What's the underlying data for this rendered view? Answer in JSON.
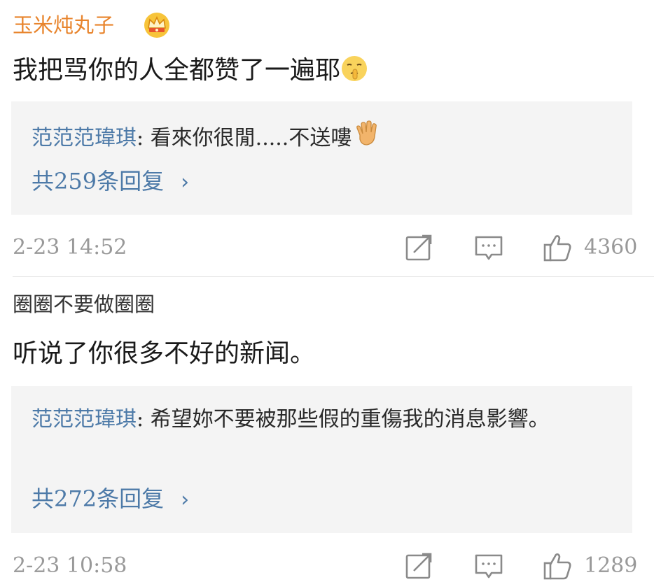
{
  "comments": [
    {
      "username": "玉米炖丸子",
      "badge_icon": "vip-crown-icon",
      "username_color": "#e8842c",
      "text": "我把骂你的人全都赞了一遍耶",
      "text_emoji": "shush-face-icon",
      "reply": {
        "author": "范范范瑋琪",
        "separator": ": ",
        "text": "看來你很閒.....不送嘍",
        "emoji": "waving-hand-icon"
      },
      "reply_count": "共259条回复",
      "timestamp": "2-23 14:52",
      "likes": "4360"
    },
    {
      "username": "圈圈不要做圈圈",
      "username_color": "#333333",
      "text": "听说了你很多不好的新闻。",
      "reply": {
        "author": "范范范瑋琪",
        "separator": ": ",
        "text": "希望妳不要被那些假的重傷我的消息影響。"
      },
      "reply_count": "共272条回复",
      "timestamp": "2-23 10:58",
      "likes": "1289"
    }
  ],
  "colors": {
    "reply_author": "#4d7aa8",
    "reply_box_bg": "#f4f4f4",
    "meta_gray": "#999999"
  }
}
